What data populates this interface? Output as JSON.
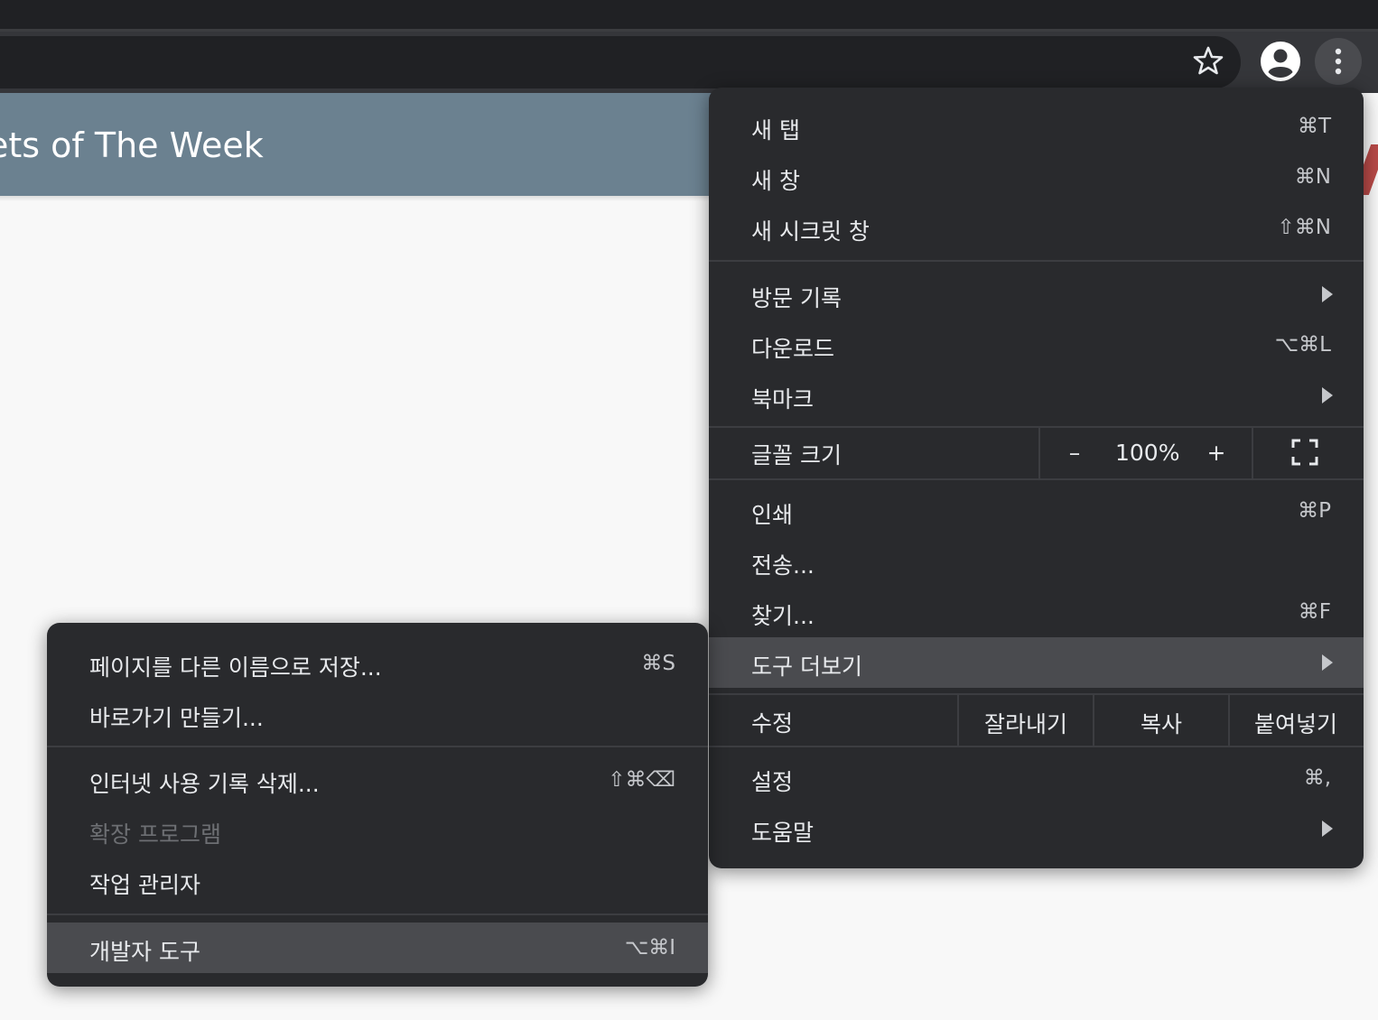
{
  "page": {
    "banner_title": "ets of The Week"
  },
  "toolbar": {
    "bookmark_icon": "star-outline-icon",
    "profile_icon": "account-circle-icon",
    "menu_icon": "vertical-ellipsis-icon"
  },
  "main_menu": {
    "new_tab": {
      "label": "새 탭",
      "shortcut": "⌘T"
    },
    "new_window": {
      "label": "새 창",
      "shortcut": "⌘N"
    },
    "new_incognito": {
      "label": "새 시크릿 창",
      "shortcut": "⇧⌘N"
    },
    "history": {
      "label": "방문 기록"
    },
    "downloads": {
      "label": "다운로드",
      "shortcut": "⌥⌘L"
    },
    "bookmarks": {
      "label": "북마크"
    },
    "zoom": {
      "label": "글꼴 크기",
      "minus": "–",
      "value": "100%",
      "plus": "+"
    },
    "print": {
      "label": "인쇄",
      "shortcut": "⌘P"
    },
    "cast": {
      "label": "전송..."
    },
    "find": {
      "label": "찾기...",
      "shortcut": "⌘F"
    },
    "more_tools": {
      "label": "도구 더보기"
    },
    "edit": {
      "label": "수정",
      "cut": "잘라내기",
      "copy": "복사",
      "paste": "붙여넣기"
    },
    "settings": {
      "label": "설정",
      "shortcut": "⌘,"
    },
    "help": {
      "label": "도움말"
    }
  },
  "sub_menu": {
    "save_page": {
      "label": "페이지를 다른 이름으로 저장...",
      "shortcut": "⌘S"
    },
    "create_shortcut": {
      "label": "바로가기 만들기..."
    },
    "clear_data": {
      "label": "인터넷 사용 기록 삭제...",
      "shortcut": "⇧⌘⌫"
    },
    "extensions": {
      "label": "확장 프로그램"
    },
    "task_manager": {
      "label": "작업 관리자"
    },
    "dev_tools": {
      "label": "개발자 도구",
      "shortcut": "⌥⌘I"
    }
  },
  "colors": {
    "menu_bg": "#292a2d",
    "highlight": "#4a4b4f",
    "banner": "#6b8190",
    "text": "#e8eaed"
  }
}
